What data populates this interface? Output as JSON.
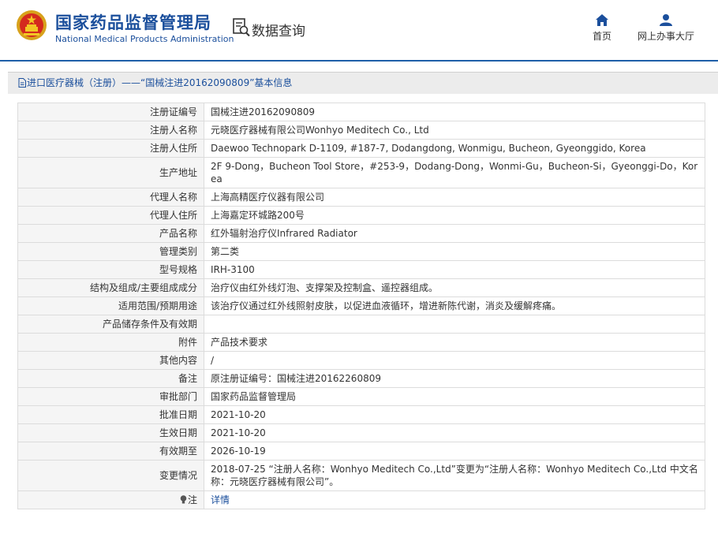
{
  "header": {
    "org_cn": "国家药品监督管理局",
    "org_en": "National Medical Products Administration",
    "data_query": "数据查询",
    "nav_home": "首页",
    "nav_hall": "网上办事大厅",
    "emblem_icon": "national-emblem-icon",
    "query_icon": "document-search-icon",
    "home_icon": "home-icon",
    "user_icon": "user-icon",
    "brand_color": "#1b4f9c"
  },
  "breadcrumb": {
    "text": "进口医疗器械（注册）——“国械注进20162090809”基本信息",
    "icon": "document-icon"
  },
  "rows": [
    {
      "label": "注册证编号",
      "value": "国械注进20162090809"
    },
    {
      "label": "注册人名称",
      "value": "元晓医疗器械有限公司Wonhyo Meditech Co., Ltd"
    },
    {
      "label": "注册人住所",
      "value": "Daewoo Technopark D-1109, #187-7, Dodangdong, Wonmigu, Bucheon, Gyeonggido, Korea"
    },
    {
      "label": "生产地址",
      "value": "2F 9-Dong，Bucheon Tool Store，#253-9，Dodang-Dong，Wonmi-Gu，Bucheon-Si，Gyeonggi-Do，Korea"
    },
    {
      "label": "代理人名称",
      "value": "上海高精医疗仪器有限公司"
    },
    {
      "label": "代理人住所",
      "value": "上海嘉定环城路200号"
    },
    {
      "label": "产品名称",
      "value": "红外辐射治疗仪Infrared Radiator"
    },
    {
      "label": "管理类别",
      "value": "第二类"
    },
    {
      "label": "型号规格",
      "value": "IRH-3100"
    },
    {
      "label": "结构及组成/主要组成成分",
      "value": "治疗仪由红外线灯泡、支撑架及控制盒、遥控器组成。"
    },
    {
      "label": "适用范围/预期用途",
      "value": "该治疗仪通过红外线照射皮肤，以促进血液循环，增进新陈代谢，消炎及缓解疼痛。"
    },
    {
      "label": "产品储存条件及有效期",
      "value": ""
    },
    {
      "label": "附件",
      "value": "产品技术要求"
    },
    {
      "label": "其他内容",
      "value": "/"
    },
    {
      "label": "备注",
      "value": "原注册证编号：国械注进20162260809"
    },
    {
      "label": "审批部门",
      "value": "国家药品监督管理局"
    },
    {
      "label": "批准日期",
      "value": "2021-10-20"
    },
    {
      "label": "生效日期",
      "value": "2021-10-20"
    },
    {
      "label": "有效期至",
      "value": "2026-10-19"
    },
    {
      "label": "变更情况",
      "value": "2018-07-25 “注册人名称：Wonhyo Meditech Co.,Ltd”变更为“注册人名称：Wonhyo Meditech Co.,Ltd 中文名称：元晓医疗器械有限公司”。"
    },
    {
      "label": "注",
      "value": "详情",
      "icon": "lightbulb-icon"
    }
  ]
}
